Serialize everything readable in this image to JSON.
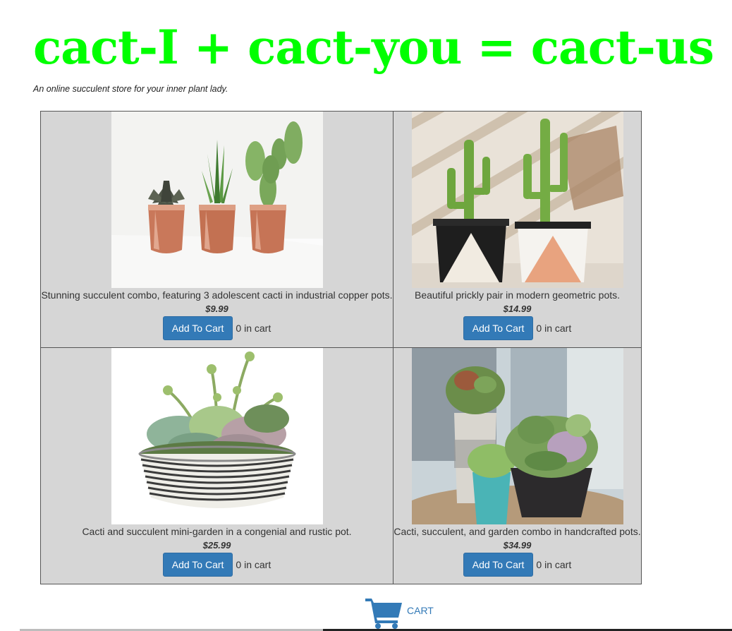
{
  "header": {
    "title": "cact-I + cact-you = cact-us",
    "tagline": "An online succulent store for your inner plant lady."
  },
  "products": [
    {
      "image_icon": "copper-pots-cacti-photo",
      "description": "Stunning succulent combo, featuring 3 adolescent cacti in industrial copper pots.",
      "price": "$9.99",
      "button_label": "Add To Cart",
      "cart_count": "0 in cart"
    },
    {
      "image_icon": "geometric-pots-cacti-photo",
      "description": "Beautiful prickly pair in modern geometric pots.",
      "price": "$14.99",
      "button_label": "Add To Cart",
      "cart_count": "0 in cart"
    },
    {
      "image_icon": "succulent-mini-garden-photo",
      "description": "Cacti and succulent mini-garden in a congenial and rustic pot.",
      "price": "$25.99",
      "button_label": "Add To Cart",
      "cart_count": "0 in cart"
    },
    {
      "image_icon": "handcrafted-pots-garden-photo",
      "description": "Cacti, succulent, and garden combo in handcrafted pots.",
      "price": "$34.99",
      "button_label": "Add To Cart",
      "cart_count": "0 in cart"
    }
  ],
  "cart": {
    "icon": "shopping-cart-icon",
    "label": "CART"
  },
  "colors": {
    "title": "#00ff00",
    "button": "#337ab7",
    "grid_background": "#d6d6d6",
    "link": "#337ab7"
  }
}
